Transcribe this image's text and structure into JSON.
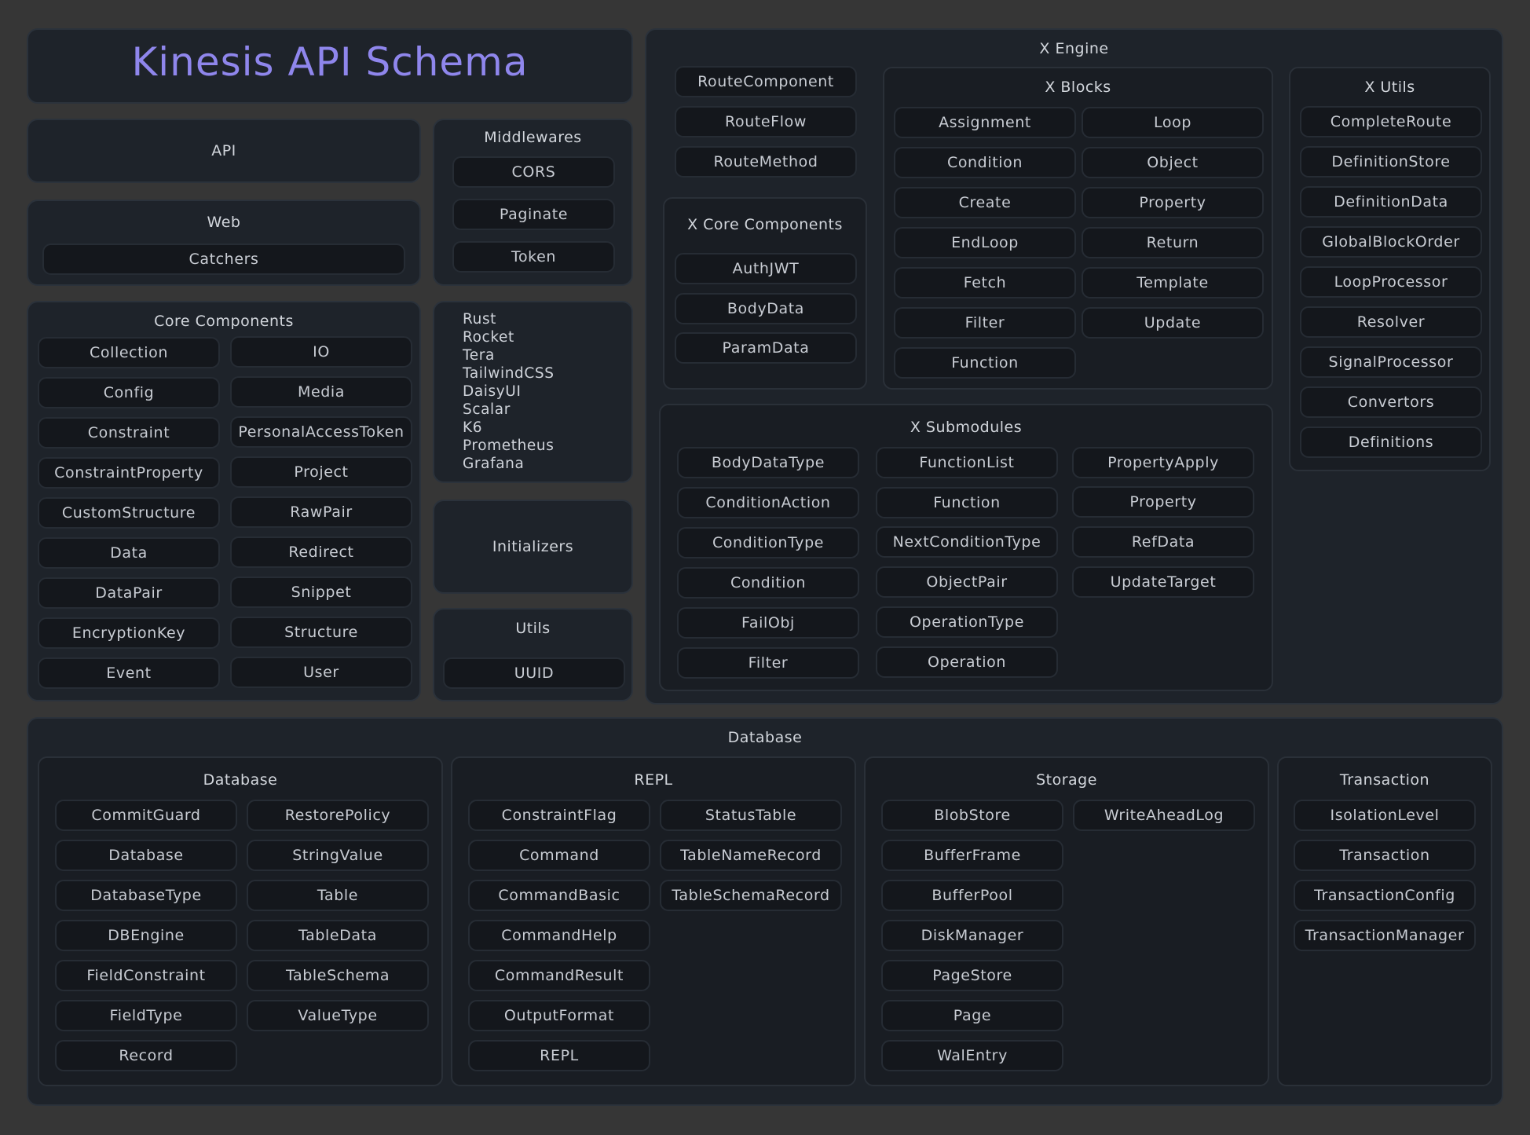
{
  "title": "Kinesis API Schema",
  "api": "API",
  "web": {
    "title": "Web",
    "items": [
      "Catchers"
    ]
  },
  "middlewares": {
    "title": "Middlewares",
    "items": [
      "CORS",
      "Paginate",
      "Token"
    ]
  },
  "core_components": {
    "title": "Core Components",
    "col1": [
      "Collection",
      "Config",
      "Constraint",
      "ConstraintProperty",
      "CustomStructure",
      "Data",
      "DataPair",
      "EncryptionKey",
      "Event"
    ],
    "col2": [
      "IO",
      "Media",
      "PersonalAccessToken",
      "Project",
      "RawPair",
      "Redirect",
      "Snippet",
      "Structure",
      "User"
    ]
  },
  "tech_stack": [
    "Rust",
    "Rocket",
    "Tera",
    "TailwindCSS",
    "DaisyUI",
    "Scalar",
    "K6",
    "Prometheus",
    "Grafana"
  ],
  "initializers": "Initializers",
  "utils": {
    "title": "Utils",
    "items": [
      "UUID"
    ]
  },
  "x_engine": {
    "title": "X Engine",
    "route_items": [
      "RouteComponent",
      "RouteFlow",
      "RouteMethod"
    ],
    "x_blocks": {
      "title": "X Blocks",
      "col1": [
        "Assignment",
        "Condition",
        "Create",
        "EndLoop",
        "Fetch",
        "Filter",
        "Function"
      ],
      "col2": [
        "Loop",
        "Object",
        "Property",
        "Return",
        "Template",
        "Update"
      ]
    },
    "x_core_components": {
      "title": "X Core Components",
      "items": [
        "AuthJWT",
        "BodyData",
        "ParamData"
      ]
    },
    "x_utils": {
      "title": "X Utils",
      "items": [
        "CompleteRoute",
        "DefinitionStore",
        "DefinitionData",
        "GlobalBlockOrder",
        "LoopProcessor",
        "Resolver",
        "SignalProcessor",
        "Convertors",
        "Definitions"
      ]
    },
    "x_submodules": {
      "title": "X Submodules",
      "col1": [
        "BodyDataType",
        "ConditionAction",
        "ConditionType",
        "Condition",
        "FailObj",
        "Filter"
      ],
      "col2": [
        "FunctionList",
        "Function",
        "NextConditionType",
        "ObjectPair",
        "OperationType",
        "Operation"
      ],
      "col3": [
        "PropertyApply",
        "Property",
        "RefData",
        "UpdateTarget"
      ]
    }
  },
  "database_section": {
    "title": "Database",
    "database": {
      "title": "Database",
      "col1": [
        "CommitGuard",
        "Database",
        "DatabaseType",
        "DBEngine",
        "FieldConstraint",
        "FieldType",
        "Record"
      ],
      "col2": [
        "RestorePolicy",
        "StringValue",
        "Table",
        "TableData",
        "TableSchema",
        "ValueType"
      ]
    },
    "repl": {
      "title": "REPL",
      "col1": [
        "ConstraintFlag",
        "Command",
        "CommandBasic",
        "CommandHelp",
        "CommandResult",
        "OutputFormat",
        "REPL"
      ],
      "col2": [
        "StatusTable",
        "TableNameRecord",
        "TableSchemaRecord"
      ]
    },
    "storage": {
      "title": "Storage",
      "col1": [
        "BlobStore",
        "BufferFrame",
        "BufferPool",
        "DiskManager",
        "PageStore",
        "Page",
        "WalEntry"
      ],
      "col2": [
        "WriteAheadLog"
      ]
    },
    "transaction": {
      "title": "Transaction",
      "col1": [
        "IsolationLevel",
        "Transaction",
        "TransactionConfig",
        "TransactionManager"
      ]
    }
  }
}
